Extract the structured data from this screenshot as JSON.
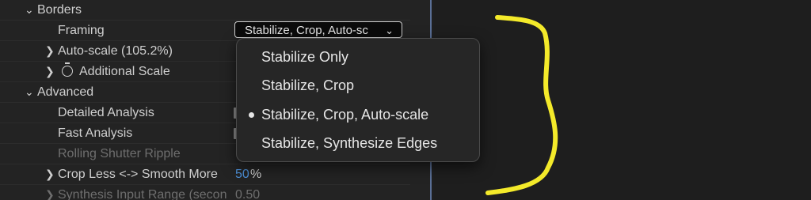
{
  "effect_controls": {
    "borders": {
      "label": "Borders",
      "framing_label": "Framing",
      "framing_value": "Stabilize, Crop, Auto-sc",
      "autoscale_label": "Auto-scale (105.2%)",
      "additional_scale_label": "Additional Scale"
    },
    "advanced": {
      "label": "Advanced",
      "detailed_analysis_label": "Detailed Analysis",
      "fast_analysis_label": "Fast Analysis",
      "rolling_shutter_label": "Rolling Shutter Ripple",
      "crop_smooth_label": "Crop Less <-> Smooth More",
      "crop_smooth_value": "50",
      "crop_smooth_unit": "%",
      "synthesis_label": "Synthesis Input Range (secon",
      "synthesis_value": "0.50"
    }
  },
  "framing_menu": {
    "items": [
      {
        "label": "Stabilize Only",
        "selected": false
      },
      {
        "label": "Stabilize, Crop",
        "selected": false
      },
      {
        "label": "Stabilize, Crop, Auto-scale",
        "selected": true
      },
      {
        "label": "Stabilize, Synthesize Edges",
        "selected": false
      }
    ]
  },
  "colors": {
    "annotation_bracket": "#f4ea2a",
    "value_blue": "#4d8fd6",
    "panel_divider": "#5a6f96"
  }
}
